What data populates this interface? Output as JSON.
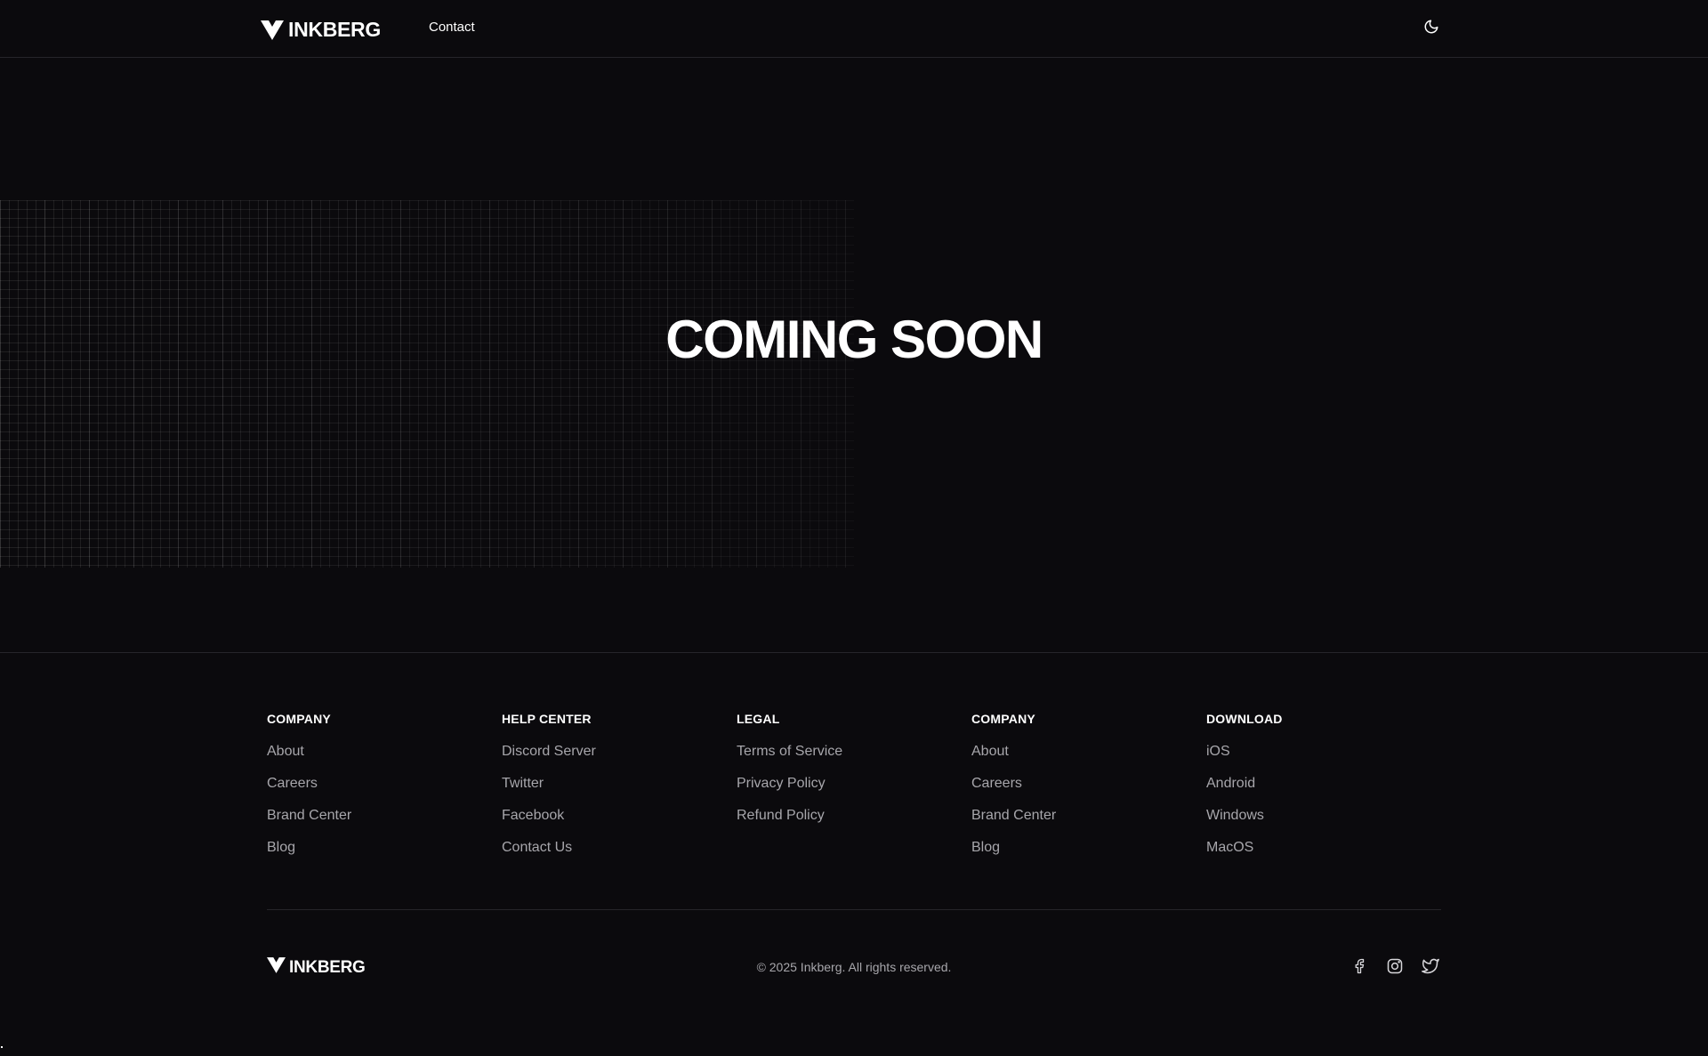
{
  "header": {
    "brand": "INKBERG",
    "nav": {
      "contact": "Contact"
    },
    "theme_toggle_icon": "moon-icon"
  },
  "hero": {
    "title": "COMING SOON"
  },
  "footer": {
    "columns": [
      {
        "heading": "COMPANY",
        "links": [
          "About",
          "Careers",
          "Brand Center",
          "Blog"
        ]
      },
      {
        "heading": "HELP CENTER",
        "links": [
          "Discord Server",
          "Twitter",
          "Facebook",
          "Contact Us"
        ]
      },
      {
        "heading": "LEGAL",
        "links": [
          "Terms of Service",
          "Privacy Policy",
          "Refund Policy"
        ]
      },
      {
        "heading": "COMPANY",
        "links": [
          "About",
          "Careers",
          "Brand Center",
          "Blog"
        ]
      },
      {
        "heading": "DOWNLOAD",
        "links": [
          "iOS",
          "Android",
          "Windows",
          "MacOS"
        ]
      }
    ],
    "brand": "INKBERG",
    "copyright": "© 2025 Inkberg. All rights reserved.",
    "socials": [
      "facebook-icon",
      "instagram-icon",
      "twitter-icon"
    ]
  },
  "colors": {
    "background": "#0b0a0d",
    "text": "#ffffff",
    "muted": "#a7a6ab",
    "border": "#26252a"
  }
}
